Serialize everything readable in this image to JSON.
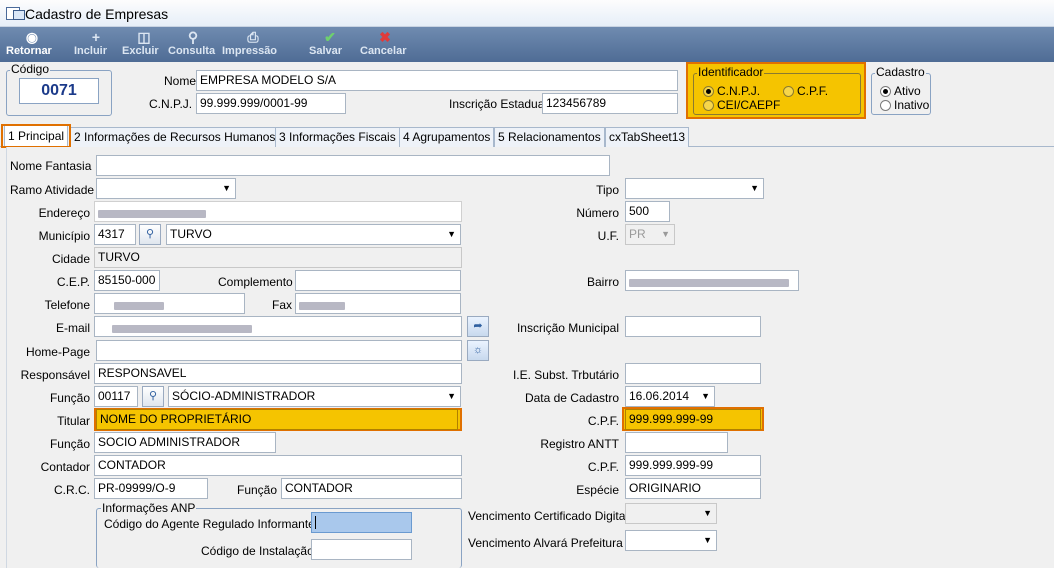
{
  "window": {
    "title": "Cadastro de Empresas"
  },
  "toolbar": {
    "retornar": "Retornar",
    "incluir": "Incluir",
    "excluir": "Excluir",
    "consulta": "Consulta",
    "impressao": "Impressão",
    "salvar": "Salvar",
    "cancelar": "Cancelar",
    "icons": {
      "retornar": "back-circle-icon",
      "incluir": "plus-icon",
      "excluir": "trash-icon",
      "consulta": "magnifier-icon",
      "impressao": "printer-icon",
      "salvar": "checkmark-icon",
      "cancelar": "x-icon"
    }
  },
  "header": {
    "codigo_label": "Código",
    "codigo_value": "0071",
    "nome_label": "Nome",
    "nome_value": "EMPRESA MODELO S/A",
    "cnpj_label": "C.N.P.J.",
    "cnpj_value": "99.999.999/0001-99",
    "ie_label": "Inscrição Estadual",
    "ie_value": "123456789",
    "identificador": {
      "legend": "Identificador",
      "cnpj": "C.N.P.J.",
      "cpf": "C.P.F.",
      "cei": "CEI/CAEPF",
      "selected": "C.N.P.J."
    },
    "cadastro": {
      "legend": "Cadastro",
      "ativo": "Ativo",
      "inativo": "Inativo",
      "selected": "Ativo"
    }
  },
  "tabs": [
    {
      "label": "1 Principal"
    },
    {
      "label": "2 Informações de Recursos Humanos"
    },
    {
      "label": "3 Informações Fiscais"
    },
    {
      "label": "4 Agrupamentos"
    },
    {
      "label": "5 Relacionamentos"
    },
    {
      "label": "cxTabSheet13"
    }
  ],
  "form": {
    "nome_fantasia": "Nome Fantasia",
    "ramo_atividade": "Ramo Atividade",
    "endereco": "Endereço",
    "municipio": "Município",
    "municipio_code": "4317",
    "municipio_name": "TURVO",
    "cidade": "Cidade",
    "cidade_value": "TURVO",
    "cep": "C.E.P.",
    "cep_value": "85150-000",
    "complemento": "Complemento",
    "telefone": "Telefone",
    "fax": "Fax",
    "email": "E-mail",
    "home_page": "Home-Page",
    "responsavel": "Responsável",
    "responsavel_value": "RESPONSAVEL",
    "funcao": "Função",
    "funcao_code": "00117",
    "funcao_name": "SÓCIO-ADMINISTRADOR",
    "titular": "Titular",
    "titular_value": "NOME DO PROPRIETÁRIO",
    "funcao2": "Função",
    "funcao2_value": "SOCIO ADMINISTRADOR",
    "contador": "Contador",
    "contador_value": "CONTADOR",
    "crc": "C.R.C.",
    "crc_value": "PR-09999/O-9",
    "funcao3": "Função",
    "funcao3_value": "CONTADOR",
    "anp": {
      "legend": "Informações ANP",
      "agente": "Código do Agente Regulado Informante",
      "instalacao": "Código de Instalação"
    },
    "tipo": "Tipo",
    "numero": "Número",
    "numero_value": "500",
    "uf": "U.F.",
    "uf_value": "PR",
    "bairro": "Bairro",
    "inscricao_municipal": "Inscrição Municipal",
    "ie_subst": "I.E. Subst. Trbutário",
    "data_cadastro": "Data de Cadastro",
    "data_cadastro_value": "16.06.2014",
    "cpf": "C.P.F.",
    "cpf_value": "999.999.999-99",
    "registro_antt": "Registro ANTT",
    "cpf2": "C.P.F.",
    "cpf2_value": "999.999.999-99",
    "especie": "Espécie",
    "especie_value": "ORIGINARIO",
    "venc_cert": "Vencimento Certificado Digital",
    "venc_alvara": "Vencimento Alvará Prefeitura"
  },
  "colors": {
    "toolbar": "#4f6c95",
    "highlight_fill": "#f5c400",
    "highlight_border": "#e07000",
    "codigo_text": "#1b3a8a"
  }
}
